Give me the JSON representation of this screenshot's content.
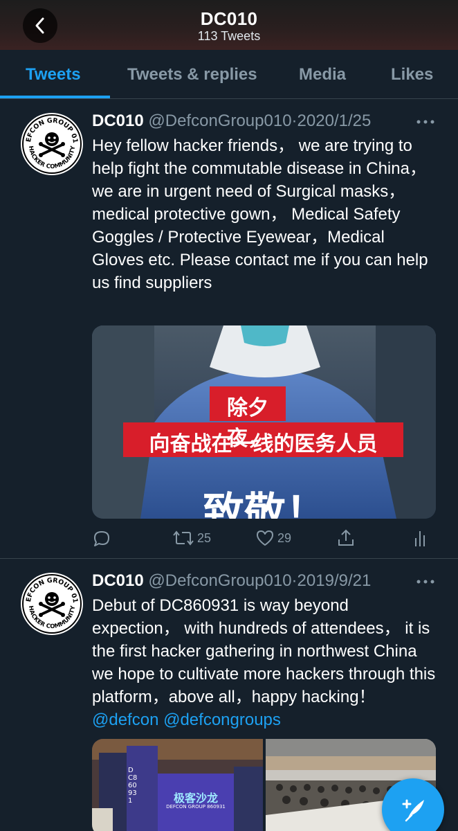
{
  "header": {
    "title": "DC010",
    "tweet_count": "113 Tweets"
  },
  "tabs": [
    {
      "label": "Tweets"
    },
    {
      "label": "Tweets & replies"
    },
    {
      "label": "Media"
    },
    {
      "label": "Likes"
    }
  ],
  "avatar": {
    "ring_top": "DEFCON GROUP 010",
    "ring_bottom": "HACKER COMMUNITY"
  },
  "tweets": [
    {
      "name": "DC010",
      "handle": "@DefconGroup010",
      "dot": "·",
      "date": "2020/1/25",
      "text": "Hey fellow hacker friends， we are trying to help fight the commutable disease in China， we are in urgent need of Surgical masks， medical protective gown， Medical Safety Goggles / Protective Eyewear，Medical Gloves etc. Please contact me if you can help us find suppliers",
      "media_caption_line1": "除夕夜，",
      "media_caption_line2": "向奋战在一线的医务人员",
      "media_caption_line3": "致敬！",
      "retweets": "25",
      "likes": "29"
    },
    {
      "name": "DC010",
      "handle": "@DefconGroup010",
      "dot": "·",
      "date": "2019/9/21",
      "text": "Debut of DC860931 is way beyond expection， with hundreds of attendees， it is the first hacker gathering in northwest China we hope to cultivate more hackers through this platform，above all，happy hacking！",
      "mentions": "@defcon @defcongroups",
      "photo_banner": "DC860931",
      "photo_stage": "极客沙龙",
      "photo_stage_sub": "DEFCON GROUP 860931"
    }
  ],
  "colors": {
    "background": "#15202b",
    "accent": "#1da1f2",
    "secondary_text": "#8899a6",
    "divider": "#38444d"
  }
}
